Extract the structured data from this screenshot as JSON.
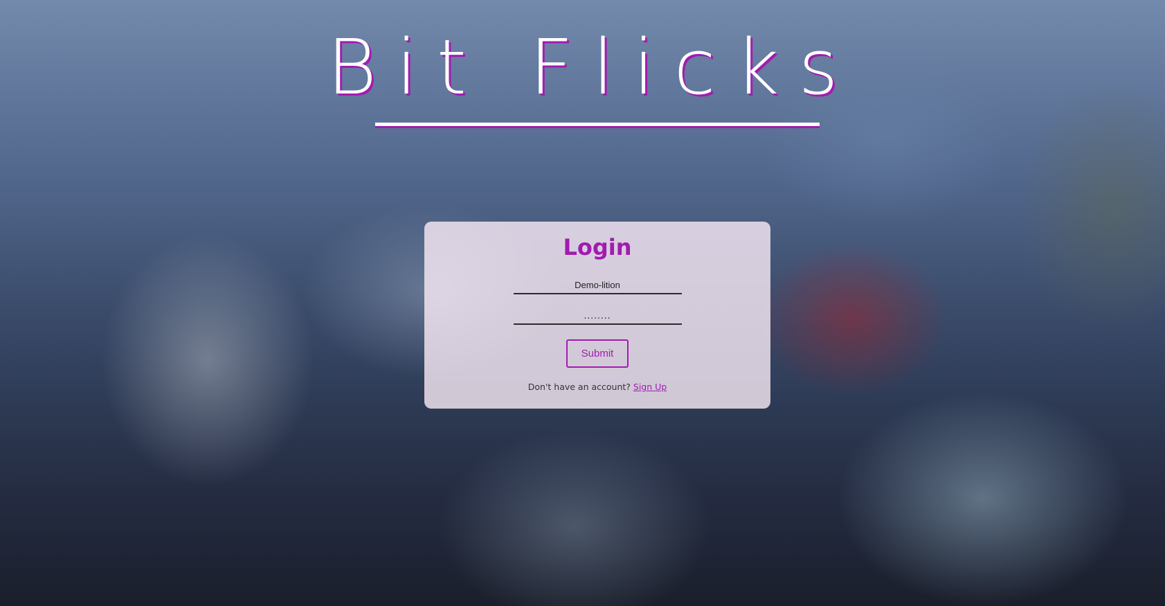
{
  "brand": {
    "title": "Bit Flicks",
    "accent_color": "#a21bb0",
    "text_color": "#ffffff"
  },
  "login": {
    "heading": "Login",
    "username_value": "Demo-lition",
    "password_value": "........",
    "submit_label": "Submit",
    "signup_prompt": "Don't have an account?",
    "signup_link": "Sign Up"
  }
}
